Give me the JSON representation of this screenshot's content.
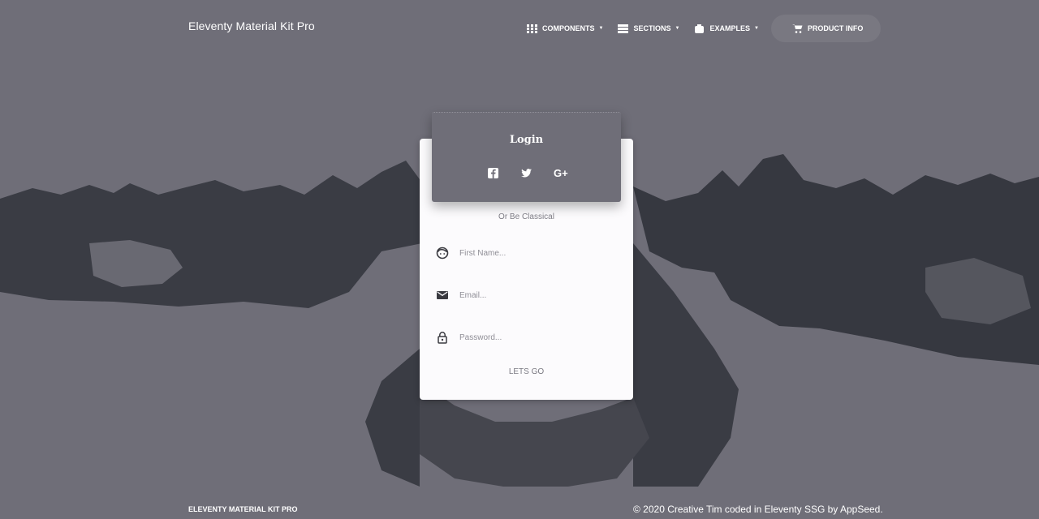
{
  "brand": "Eleventy Material Kit Pro",
  "nav": {
    "components": "COMPONENTS",
    "sections": "SECTIONS",
    "examples": "EXAMPLES",
    "product_info": "PRODUCT INFO"
  },
  "login": {
    "title": "Login",
    "socials": [
      "facebook-icon",
      "twitter-icon",
      "google-plus-icon"
    ],
    "divider": "Or Be Classical",
    "first_name_placeholder": "First Name...",
    "email_placeholder": "Email...",
    "password_placeholder": "Password...",
    "submit": "LETS GO"
  },
  "footer": {
    "left": "ELEVENTY MATERIAL KIT PRO",
    "right": "© 2020 Creative Tim coded in Eleventy SSG by AppSeed."
  },
  "colors": {
    "background": "#6f6e78",
    "mountains": "#363840",
    "card": "#fcfbfd"
  }
}
